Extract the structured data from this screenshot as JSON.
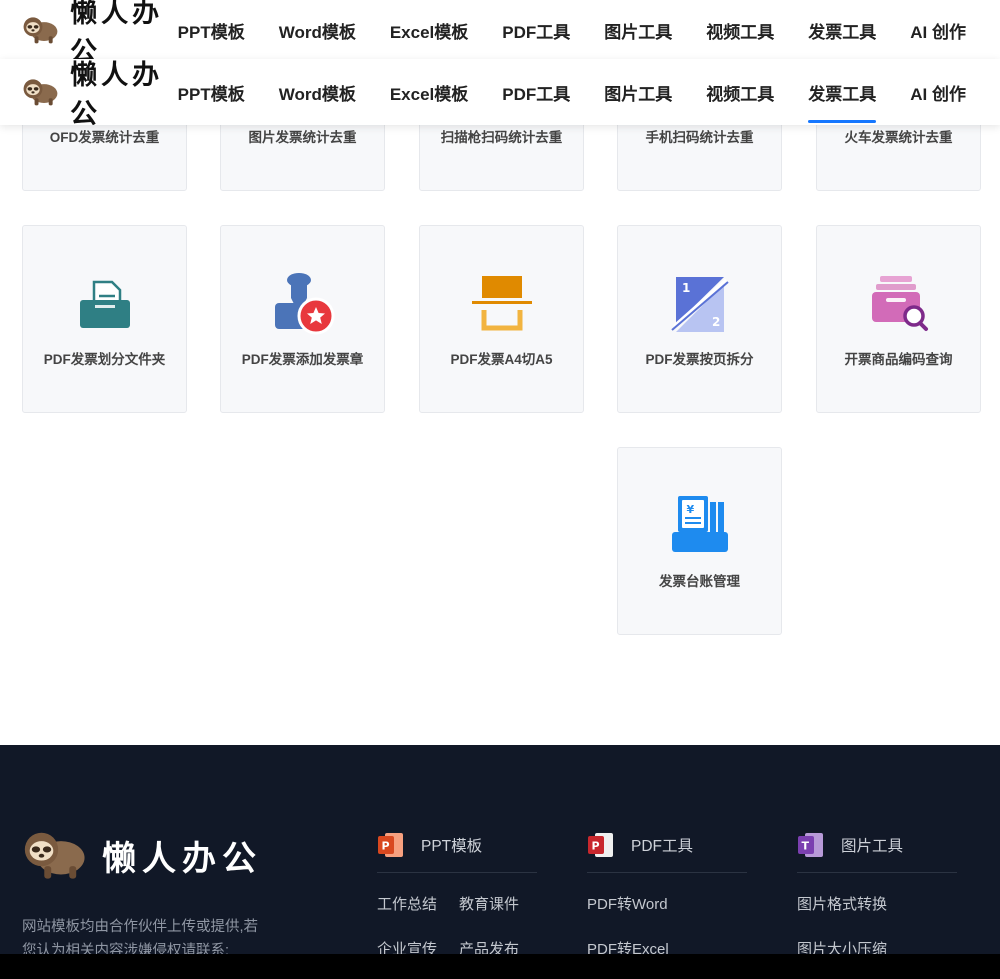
{
  "brand": {
    "name": "懒人办公"
  },
  "nav": {
    "items": [
      {
        "label": "PPT模板"
      },
      {
        "label": "Word模板"
      },
      {
        "label": "Excel模板"
      },
      {
        "label": "PDF工具"
      },
      {
        "label": "图片工具"
      },
      {
        "label": "视频工具"
      },
      {
        "label": "发票工具"
      },
      {
        "label": "AI 创作"
      }
    ],
    "active": "发票工具"
  },
  "tools": {
    "row0": [
      "OFD发票统计去重",
      "图片发票统计去重",
      "扫描枪扫码统计去重",
      "手机扫码统计去重",
      "火车发票统计去重"
    ],
    "row1": [
      {
        "label": "PDF发票划分文件夹",
        "icon": "folder-icon"
      },
      {
        "label": "PDF发票添加发票章",
        "icon": "stamp-icon"
      },
      {
        "label": "PDF发票A4切A5",
        "icon": "cut-page-icon"
      },
      {
        "label": "PDF发票按页拆分",
        "icon": "split-page-icon"
      },
      {
        "label": "开票商品编码查询",
        "icon": "code-search-icon"
      }
    ],
    "row2": [
      {
        "label": "发票台账管理",
        "icon": "ledger-icon"
      }
    ]
  },
  "footer": {
    "brand": "懒人办公",
    "description": "网站模板均由合作伙伴上传或提供,若您认为相关内容涉嫌侵权请联系:",
    "columns": [
      {
        "title": "PPT模板",
        "icon": "ppt-icon",
        "links": [
          "工作总结",
          "教育课件",
          "企业宣传",
          "产品发布"
        ]
      },
      {
        "title": "PDF工具",
        "icon": "pdf-icon",
        "links": [
          "PDF转Word",
          "PDF转Excel"
        ]
      },
      {
        "title": "图片工具",
        "icon": "image-tool-icon",
        "links": [
          "图片格式转换",
          "图片大小压缩"
        ]
      }
    ]
  },
  "colors": {
    "accent": "#1677ff",
    "footer_bg": "#111827",
    "teal": "#2f7f84",
    "stamp_blue": "#4b74b8",
    "stamp_red": "#e8383d",
    "orange": "#e08a00",
    "ledger_blue": "#1e8bef",
    "pink": "#d26bb8"
  }
}
